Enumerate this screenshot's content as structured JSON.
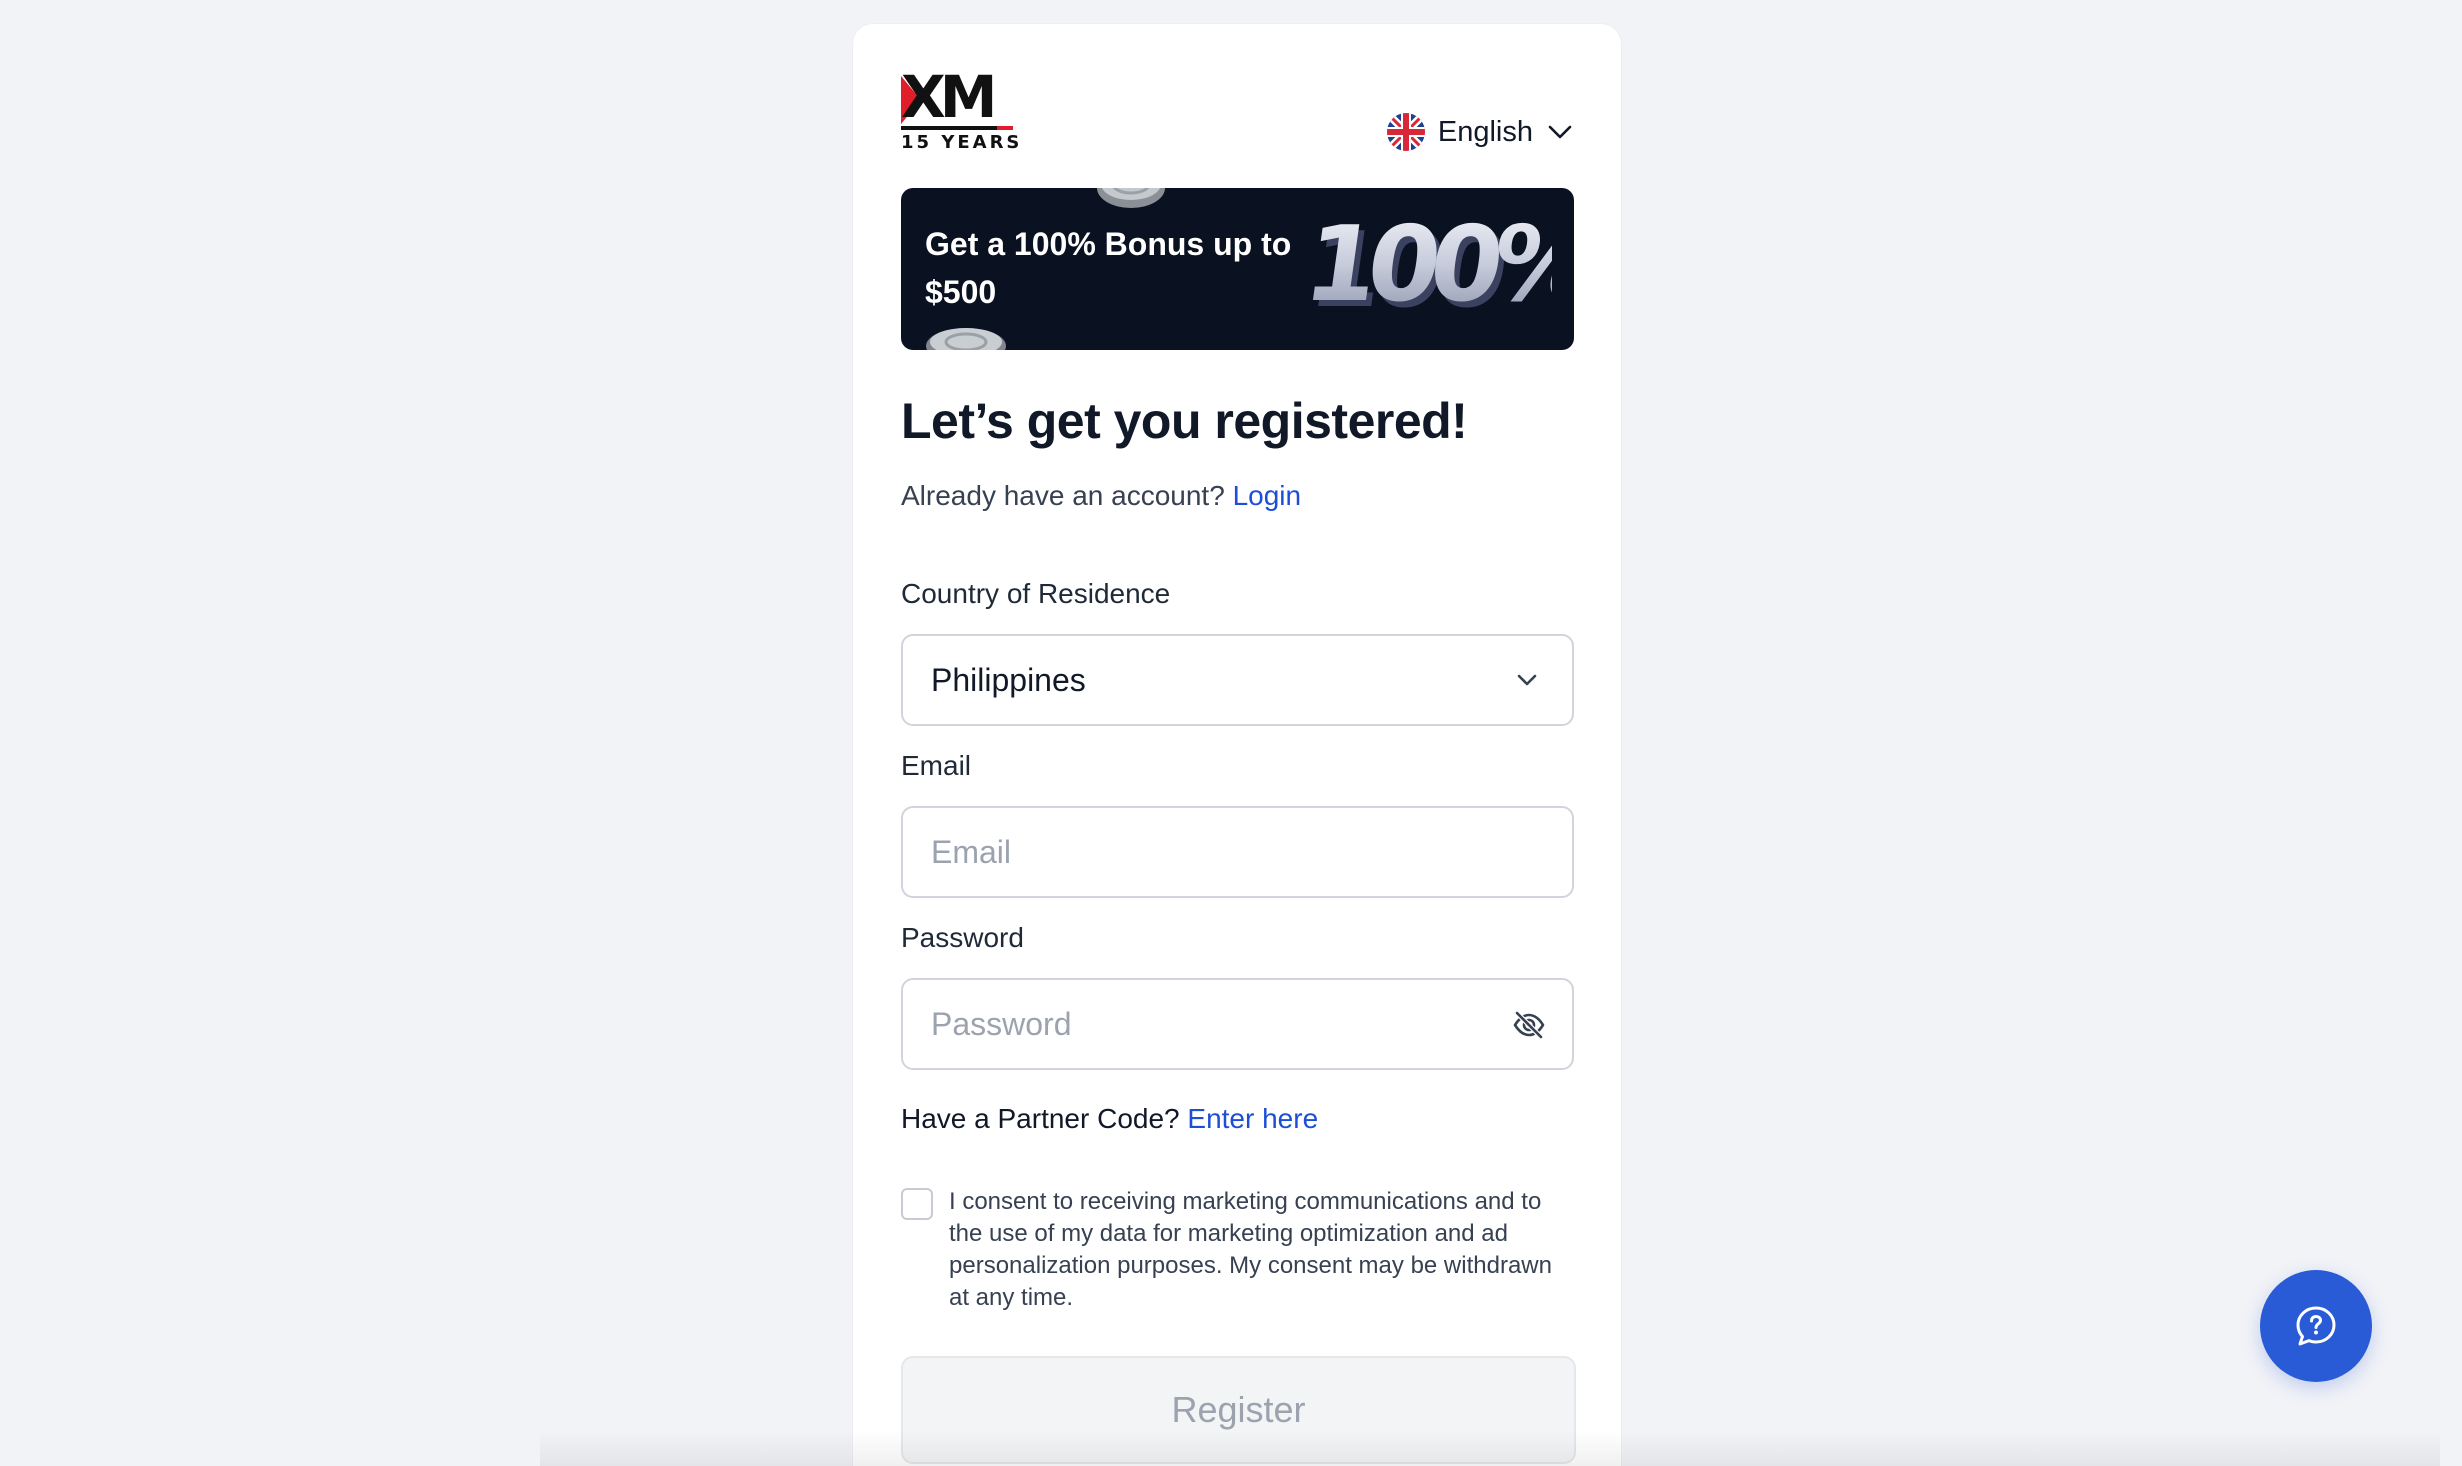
{
  "brand": {
    "logo_text": "XM",
    "logo_subtext": "15 YEARS",
    "accent_color": "#e11d2a"
  },
  "language": {
    "selected": "English",
    "flag_icon": "uk-flag-icon"
  },
  "banner": {
    "headline": "Get a 100% Bonus up to $500",
    "graphic_text": "100%",
    "background_color": "#0a1120"
  },
  "form": {
    "title": "Let’s get you registered!",
    "already_prompt": "Already have an account?",
    "login_link": "Login",
    "country": {
      "label": "Country of Residence",
      "value": "Philippines"
    },
    "email": {
      "label": "Email",
      "placeholder": "Email",
      "value": ""
    },
    "password": {
      "label": "Password",
      "placeholder": "Password",
      "value": ""
    },
    "partner_prompt": "Have a Partner Code?",
    "partner_link": "Enter here",
    "consent": {
      "checked": false,
      "text": "I consent to receiving marketing communications and to the use of my data for marketing optimization and ad personalization purposes. My consent may be withdrawn at any time."
    },
    "register_label": "Register",
    "link_color": "#1d4ed8"
  },
  "help_button": {
    "icon": "help-chat-icon",
    "color": "#2a5bd7"
  }
}
